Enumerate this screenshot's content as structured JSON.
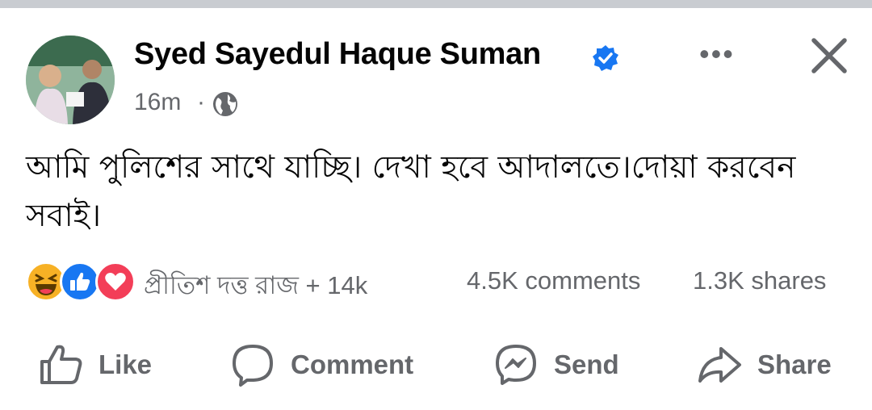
{
  "post": {
    "author": "Syed Sayedul Haque Suman",
    "time": "16m",
    "separator": "·",
    "text": "আমি পুলিশের সাথে যাচ্ছি। দেখা হবে আদালতে।দোয়া করবেন সবাই।"
  },
  "stats": {
    "reaction_names": "প্রীতিশ দত্ত রাজ + 14k",
    "comments": "4.5K comments",
    "shares": "1.3K shares",
    "reaction_icons": [
      "haha-icon",
      "like-icon",
      "love-icon"
    ]
  },
  "actions": {
    "like": "Like",
    "comment": "Comment",
    "send": "Send",
    "share": "Share"
  },
  "menu": {
    "more": "•••"
  },
  "colors": {
    "accent": "#1877f2",
    "muted": "#65676b",
    "love": "#f33e58",
    "haha": "#f7b125"
  }
}
